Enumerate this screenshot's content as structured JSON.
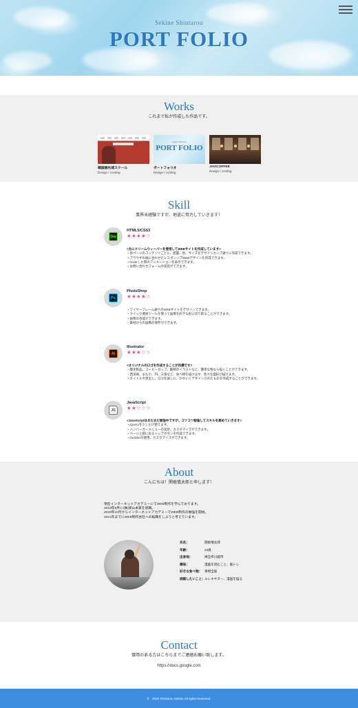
{
  "hero": {
    "subtitle": "Sekine Shintarou",
    "title": "PORT FOLIO"
  },
  "menu": {
    "icon": "hamburger-menu-icon"
  },
  "works": {
    "title": "Works",
    "subtitle": "これまで私が作成した作品です。",
    "items": [
      {
        "name": "韓国語光城スクール",
        "category": "Design / cording"
      },
      {
        "name": "ポートフォリオ",
        "category": "Design / cording",
        "thumb_title": "PORT FOLIO",
        "thumb_sub": "Sekine Shintarou"
      },
      {
        "name": "JAVICOFFEE",
        "category": "Design / cording"
      }
    ]
  },
  "skill": {
    "title": "Skill",
    "subtitle": "業界未経験ですが、地道に努力していきます！",
    "items": [
      {
        "icon_label": "Dw",
        "name": "HTML5/CSS3",
        "stars": "★★★★☆",
        "rating": 4,
        "lines": [
          "<主にドリームウィーバーを使用してWEBサイトを作成しています>",
          "・各ページのコンテンツごとに、配置、色、サイズをデザインカンプ通りに作成できます。",
          "・ブラウザの幅に合わせたレスポンシブWEBデザインを作成できます。",
          "・hoverした際のアニメーションを表示できます。",
          "・お問い合わせフォームの実装ができます。"
        ]
      },
      {
        "icon_label": "Ps",
        "name": "PhotoShop",
        "stars": "★★★★☆",
        "rating": 4,
        "lines": [
          "・ワイヤーフレーム通りのWEBサイトをデザインできます。",
          "・クイック選択ツールを使って画像を好きな形に切り取ることができます。",
          "・画像の合成ができます。",
          "・素材からの画像の保存ができます。"
        ]
      },
      {
        "icon_label": "Ai",
        "name": "Illustrator",
        "stars": "★★★☆☆",
        "rating": 3,
        "lines": [
          "<オリジナルのロゴを作成することが目標です>",
          "・電化製品、コーヒーカップ、動物のイラストなど、簡単な物なら描くことができます。",
          "・西洋風、まだ小、円、三角など、食べ物を描けます、色々な図形が描けます。",
          "・タイトルや見出し、ロゴを試しに、かわいくデザインされたものを作成することができます。"
        ]
      },
      {
        "icon_label": "JS",
        "name": "JavaScript",
        "stars": "★★☆☆☆",
        "rating": 2,
        "lines": [
          "<JavaScriptはまだまだ勉強中ですが、コツコツ勉強してスキルを高めていきます>",
          "・jQueryを少しだけ使えます。",
          "・ハンバーガーメニューの実装、カスタマイズができます。",
          "・ページ上部に戻るトップボタンを作成できます。",
          "・bxsliderの使用、カスタマイズができます。"
        ]
      }
    ]
  },
  "about": {
    "title": "About",
    "subtitle": "こんにちは！関根慎太郎と申します！",
    "text": [
      "現在インターネットアカデミーにてWEB制作を学んでおります。",
      "2019年9月に(株)東山本家を退職。",
      "2020年10月からインターネットアカデミーでWEB制作の勉強を開始。",
      "2021年までにWEB制作会社への転職をしようと考えています。"
    ],
    "profile": [
      {
        "key": "氏名：",
        "value": "関根慎太郎"
      },
      {
        "key": "年齢：",
        "value": "23歳"
      },
      {
        "key": "出身地：",
        "value": "埼玉県川越市"
      },
      {
        "key": "趣味：",
        "value": "漫画を読むこと、筋トレ"
      },
      {
        "key": "好きな食べ物：",
        "value": "果物全般"
      },
      {
        "key": "挑戦したいこと：",
        "value": "エレキギター、漫画を描る"
      }
    ]
  },
  "contact": {
    "title": "Contact",
    "subtitle": "御用のある方はこちらまでご連絡お願い致します。",
    "link": "https://docs.google.com"
  },
  "footer": {
    "text": "©　2020 Shintarou Sekine All rights Reserved."
  },
  "colors": {
    "accent": "#2a78c7",
    "footer": "#3d8de0",
    "star": "#e64c8a",
    "section_gray": "#f0f0f0"
  }
}
